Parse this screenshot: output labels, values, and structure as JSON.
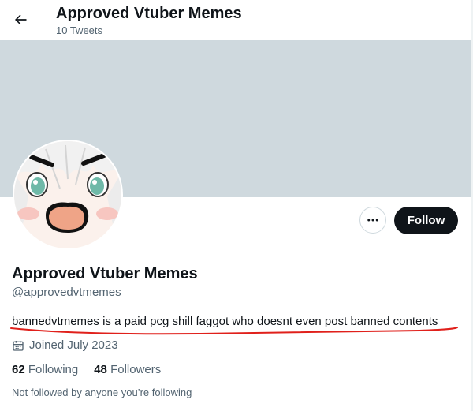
{
  "header": {
    "title": "Approved Vtuber Memes",
    "tweet_count": "10 Tweets",
    "back_icon": "arrow-left-icon"
  },
  "profile": {
    "display_name": "Approved Vtuber Memes",
    "handle": "@approvedvtmemes",
    "bio_mention": "bannedvtmemes",
    "bio_rest": " is a paid pcg shill faggot who doesnt even post banned contents",
    "joined": "Joined July 2023",
    "following_count": "62",
    "following_label": " Following",
    "followers_count": "48",
    "followers_label": " Followers",
    "not_followed": "Not followed by anyone you’re following"
  },
  "actions": {
    "follow_label": "Follow",
    "more_icon": "more-horizontal-icon"
  },
  "colors": {
    "banner": "#cfd9de",
    "primary_text": "#0f1419",
    "secondary_text": "#536471",
    "follow_bg": "#0f1419",
    "annotation_red": "#e0201b"
  }
}
